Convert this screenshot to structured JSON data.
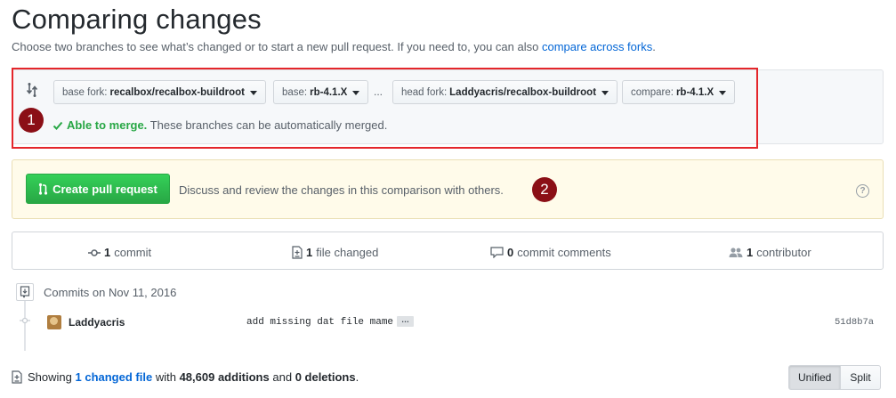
{
  "header": {
    "title": "Comparing changes",
    "subtitle_prefix": "Choose two branches to see what’s changed or to start a new pull request. If you need to, you can also ",
    "compare_forks_link": "compare across forks",
    "subtitle_suffix": "."
  },
  "range": {
    "base_fork": {
      "label": "base fork:",
      "value": "recalbox/recalbox-buildroot"
    },
    "base": {
      "label": "base:",
      "value": "rb-4.1.X"
    },
    "ellipsis": "...",
    "head_fork": {
      "label": "head fork:",
      "value": "Laddyacris/recalbox-buildroot"
    },
    "compare": {
      "label": "compare:",
      "value": "rb-4.1.X"
    },
    "merge_status_ok": "Able to merge.",
    "merge_status_text": "These branches can be automatically merged."
  },
  "annotations": {
    "badge1": "1",
    "badge2": "2"
  },
  "pull_request": {
    "button_label": "Create pull request",
    "description": "Discuss and review the changes in this comparison with others.",
    "help": "?"
  },
  "stats": {
    "commits": {
      "count": "1",
      "label": "commit"
    },
    "files": {
      "count": "1",
      "label": "file changed"
    },
    "comments": {
      "count": "0",
      "label": "commit comments"
    },
    "contributors": {
      "count": "1",
      "label": "contributor"
    }
  },
  "commits": {
    "date_header": "Commits on Nov 11, 2016",
    "items": [
      {
        "author": "Laddyacris",
        "message": "add missing dat file mame",
        "expand": "…",
        "sha": "51d8b7a"
      }
    ]
  },
  "summary": {
    "prefix": "Showing",
    "changed_files": "1 changed file",
    "with": "with",
    "additions": "48,609 additions",
    "and": "and",
    "deletions": "0 deletions",
    "suffix": "."
  },
  "view_toggle": {
    "unified": "Unified",
    "split": "Split",
    "selected": "Unified"
  },
  "colors": {
    "annotation_red": "#e4262b",
    "badge": "#8b0f16",
    "success": "#28a745",
    "link": "#0366d6"
  }
}
